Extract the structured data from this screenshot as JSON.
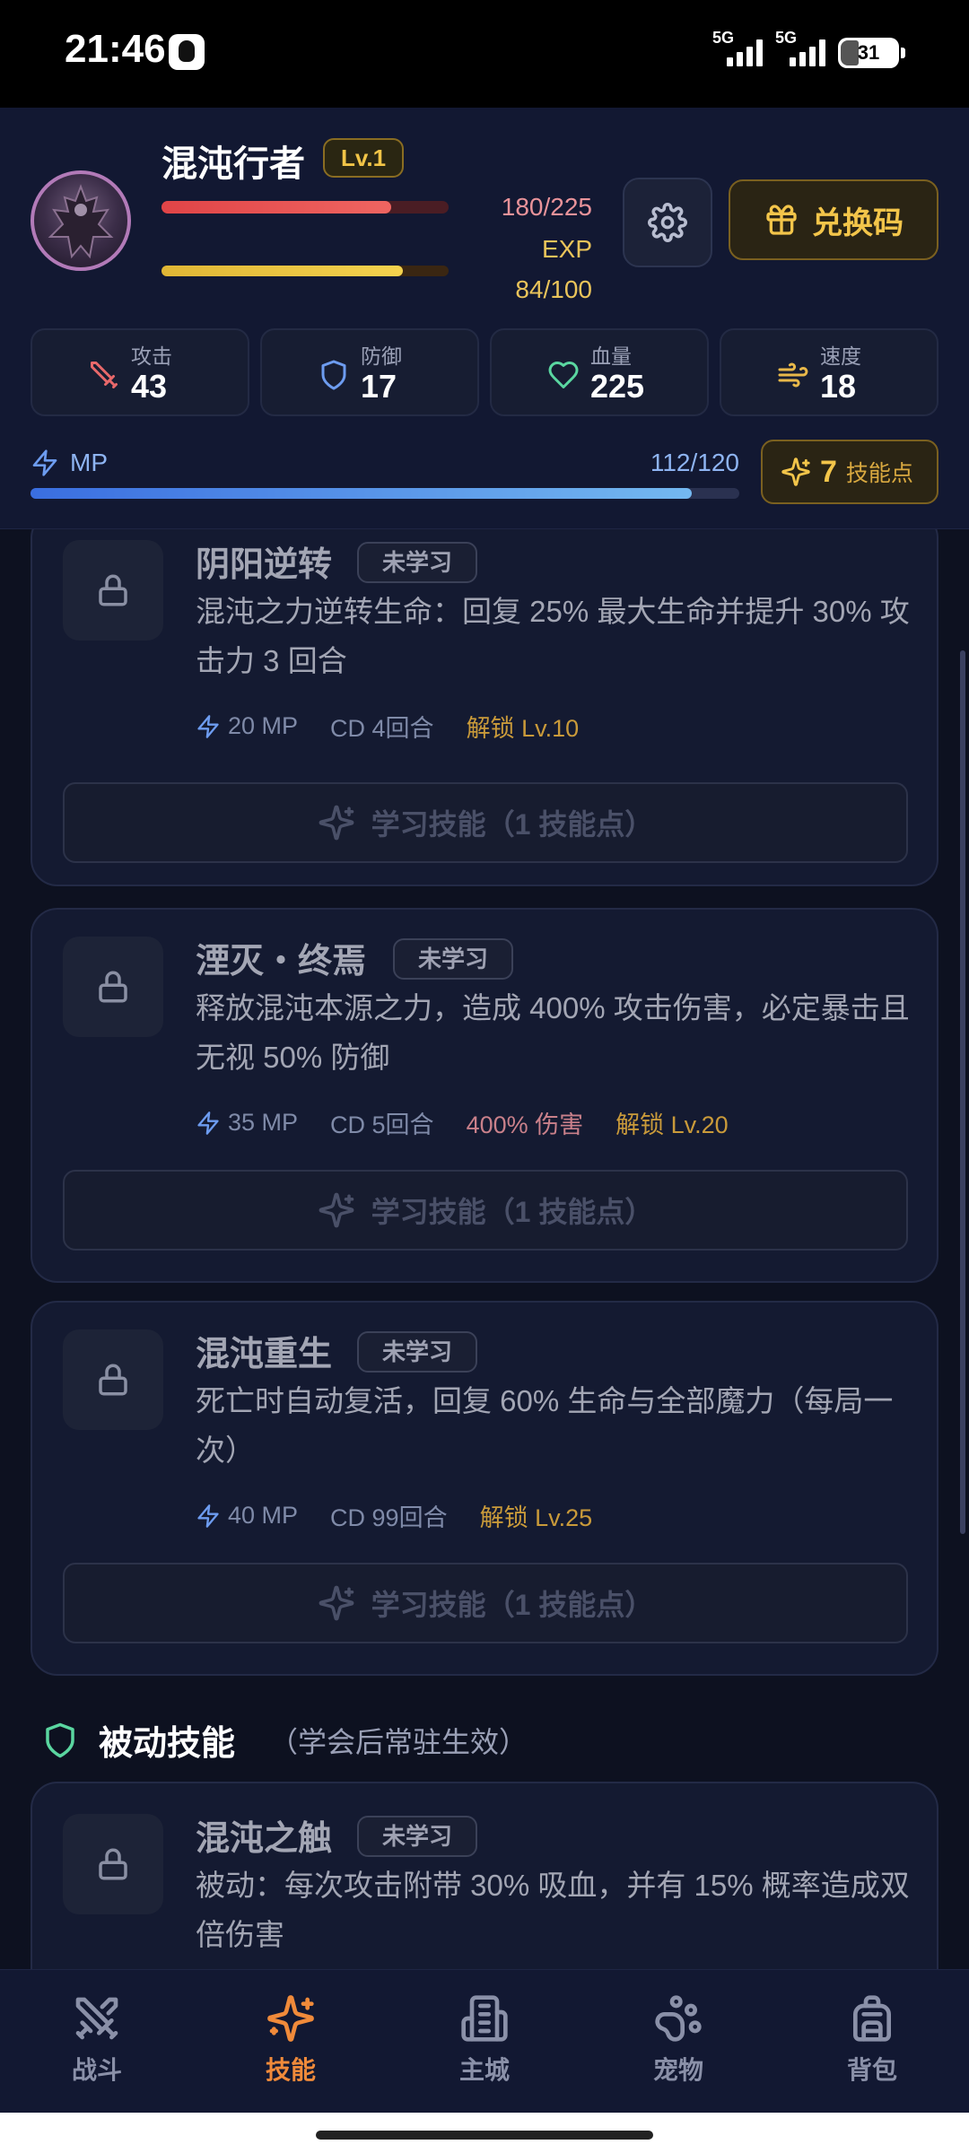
{
  "status_bar": {
    "time": "21:46",
    "network_1": "5G",
    "network_2": "5G",
    "battery": "31"
  },
  "player": {
    "name": "混沌行者",
    "level": "Lv.1",
    "hp": "180/225",
    "hp_fraction": 0.8,
    "exp_label": "EXP",
    "exp": "84/100",
    "exp_fraction": 0.84,
    "redeem_label": "兑换码"
  },
  "stats": [
    {
      "label": "攻击",
      "value": "43",
      "icon": "sword-icon",
      "color": "#e8686a"
    },
    {
      "label": "防御",
      "value": "17",
      "icon": "shield-icon",
      "color": "#6d9cf0"
    },
    {
      "label": "血量",
      "value": "225",
      "icon": "heart-icon",
      "color": "#5ad6a0"
    },
    {
      "label": "速度",
      "value": "18",
      "icon": "wind-icon",
      "color": "#e8b84a"
    }
  ],
  "mp": {
    "label": "MP",
    "value": "112/120",
    "fraction": 0.933
  },
  "skill_points": {
    "count": "7",
    "label": "技能点"
  },
  "skills": [
    {
      "name": "阴阳逆转",
      "status": "未学习",
      "desc": "混沌之力逆转生命：回复 25% 最大生命并提升 30% 攻击力 3 回合",
      "mp": "20 MP",
      "cd": "CD 4回合",
      "damage": "",
      "unlock": "解锁 Lv.10",
      "learn": "学习技能（1 技能点）"
    },
    {
      "name": "湮灭・终焉",
      "status": "未学习",
      "desc": "释放混沌本源之力，造成 400% 攻击伤害，必定暴击且无视 50% 防御",
      "mp": "35 MP",
      "cd": "CD 5回合",
      "damage": "400% 伤害",
      "unlock": "解锁 Lv.20",
      "learn": "学习技能（1 技能点）"
    },
    {
      "name": "混沌重生",
      "status": "未学习",
      "desc": "死亡时自动复活，回复 60% 生命与全部魔力（每局一次）",
      "mp": "40 MP",
      "cd": "CD 99回合",
      "damage": "",
      "unlock": "解锁 Lv.25",
      "learn": "学习技能（1 技能点）"
    }
  ],
  "passive": {
    "title": "被动技能",
    "subtitle": "（学会后常驻生效）",
    "skill": {
      "name": "混沌之触",
      "status": "未学习",
      "desc": "被动：每次攻击附带 30% 吸血，并有 15% 概率造成双倍伤害"
    }
  },
  "nav": [
    {
      "label": "战斗",
      "icon": "swords-icon",
      "active": false
    },
    {
      "label": "技能",
      "icon": "sparkles-icon",
      "active": true
    },
    {
      "label": "主城",
      "icon": "castle-icon",
      "active": false
    },
    {
      "label": "宠物",
      "icon": "paw-icon",
      "active": false
    },
    {
      "label": "背包",
      "icon": "backpack-icon",
      "active": false
    }
  ],
  "colors": {
    "accent_gold": "#f3c54a",
    "accent_orange": "#f08a3a",
    "hp": "#e04447",
    "mp": "#4a86e8"
  }
}
